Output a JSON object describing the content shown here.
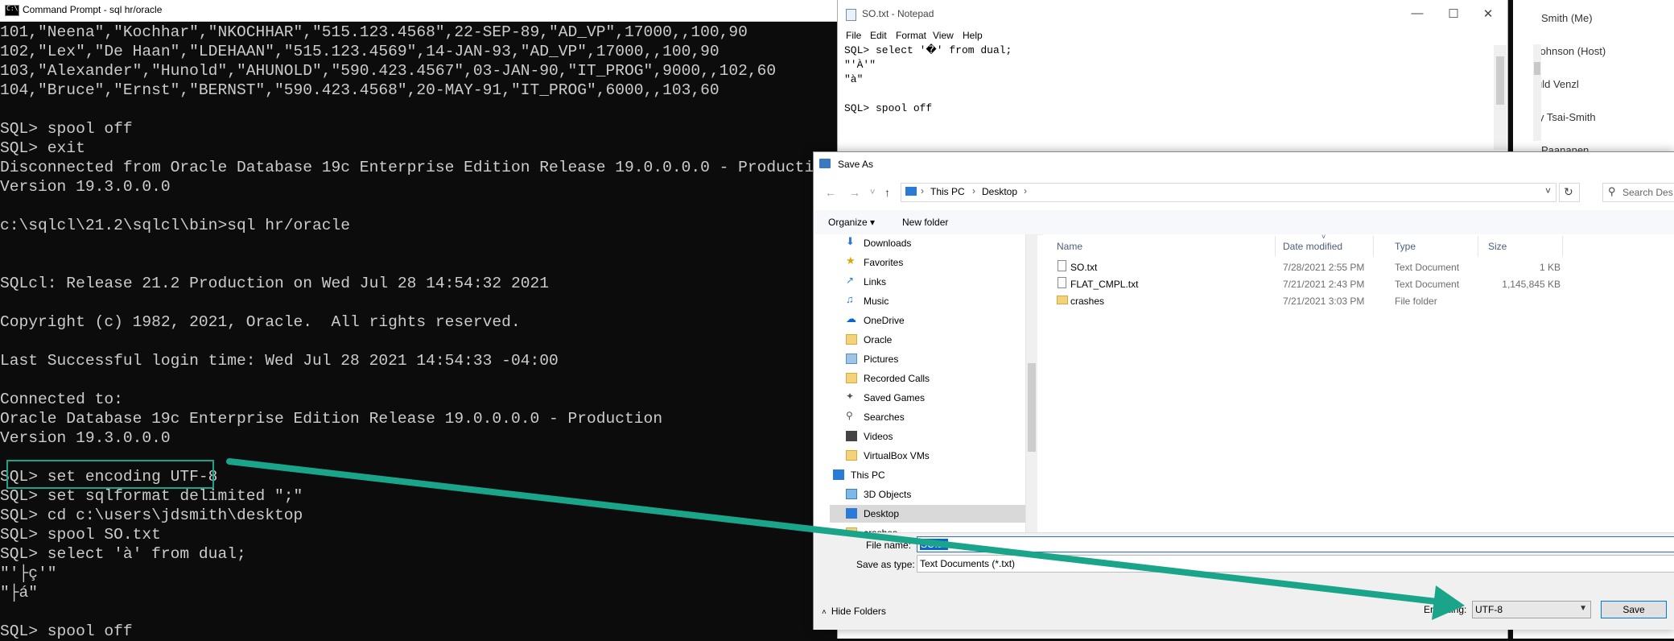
{
  "cmd": {
    "title": "Command Prompt - sql  hr/oracle",
    "lines": [
      "101,\"Neena\",\"Kochhar\",\"NKOCHHAR\",\"515.123.4568\",22-SEP-89,\"AD_VP\",17000,,100,90",
      "102,\"Lex\",\"De Haan\",\"LDEHAAN\",\"515.123.4569\",14-JAN-93,\"AD_VP\",17000,,100,90",
      "103,\"Alexander\",\"Hunold\",\"AHUNOLD\",\"590.423.4567\",03-JAN-90,\"IT_PROG\",9000,,102,60",
      "104,\"Bruce\",\"Ernst\",\"BERNST\",\"590.423.4568\",20-MAY-91,\"IT_PROG\",6000,,103,60",
      "",
      "SQL> spool off",
      "SQL> exit",
      "Disconnected from Oracle Database 19c Enterprise Edition Release 19.0.0.0.0 - Production",
      "Version 19.3.0.0.0",
      "",
      "c:\\sqlcl\\21.2\\sqlcl\\bin>sql hr/oracle",
      "",
      "",
      "SQLcl: Release 21.2 Production on Wed Jul 28 14:54:32 2021",
      "",
      "Copyright (c) 1982, 2021, Oracle.  All rights reserved.",
      "",
      "Last Successful login time: Wed Jul 28 2021 14:54:33 -04:00",
      "",
      "Connected to:",
      "Oracle Database 19c Enterprise Edition Release 19.0.0.0.0 - Production",
      "Version 19.3.0.0.0",
      "",
      "SQL> set encoding UTF-8",
      "SQL> set sqlformat delimited \";\"",
      "SQL> cd c:\\users\\jdsmith\\desktop",
      "SQL> spool SO.txt",
      "SQL> select 'à' from dual;",
      "\"'├ç'\"",
      "\"├á\"",
      "",
      "SQL> spool off"
    ]
  },
  "participants": [
    "Smith (Me)",
    "Johnson (Host)",
    "uld Venzl",
    "y Tsai-Smith",
    "Paananen"
  ],
  "notepad": {
    "title": "SO.txt - Notepad",
    "menu": [
      "File",
      "Edit",
      "Format",
      "View",
      "Help"
    ],
    "lines": [
      "SQL> select '�' from dual;",
      "\"'À'\"",
      "\"à\"",
      "",
      "SQL> spool off"
    ]
  },
  "save_as": {
    "title": "Save As",
    "breadcrumb": [
      "This PC",
      "Desktop"
    ],
    "search_placeholder": "Search Des",
    "organize": "Organize ▾",
    "new_folder": "New folder",
    "nav_items": [
      {
        "label": "Downloads",
        "icon": "download-icon"
      },
      {
        "label": "Favorites",
        "icon": "star-icon"
      },
      {
        "label": "Links",
        "icon": "link-icon"
      },
      {
        "label": "Music",
        "icon": "music-icon"
      },
      {
        "label": "OneDrive",
        "icon": "cloud-icon"
      },
      {
        "label": "Oracle",
        "icon": "folder-icon"
      },
      {
        "label": "Pictures",
        "icon": "pictures-icon"
      },
      {
        "label": "Recorded Calls",
        "icon": "folder-icon"
      },
      {
        "label": "Saved Games",
        "icon": "games-icon"
      },
      {
        "label": "Searches",
        "icon": "search-icon"
      },
      {
        "label": "Videos",
        "icon": "video-icon"
      },
      {
        "label": "VirtualBox VMs",
        "icon": "folder-icon"
      },
      {
        "label": "This PC",
        "icon": "computer-icon"
      },
      {
        "label": "3D Objects",
        "icon": "cube-icon"
      },
      {
        "label": "Desktop",
        "icon": "desktop-icon"
      },
      {
        "label": "crashes",
        "icon": "folder-icon"
      }
    ],
    "columns": {
      "name": "Name",
      "date": "Date modified",
      "type": "Type",
      "size": "Size"
    },
    "files": [
      {
        "name": "SO.txt",
        "date": "7/28/2021 2:55 PM",
        "type": "Text Document",
        "size": "1 KB",
        "icon": "text-file-icon"
      },
      {
        "name": "FLAT_CMPL.txt",
        "date": "7/21/2021 2:43 PM",
        "type": "Text Document",
        "size": "1,145,845 KB",
        "icon": "text-file-icon"
      },
      {
        "name": "crashes",
        "date": "7/21/2021 3:03 PM",
        "type": "File folder",
        "size": "",
        "icon": "folder-icon"
      }
    ],
    "file_name_label": "File name:",
    "file_name_value": "SO.txt",
    "save_as_type_label": "Save as type:",
    "save_as_type_value": "Text Documents (*.txt)",
    "hide_folders": "Hide Folders",
    "encoding_label": "Encoding:",
    "encoding_value": "UTF-8",
    "save_button": "Save"
  },
  "colors": {
    "accent": "#1aa58a",
    "cmd_bg": "#0c0c0c",
    "cmd_fg": "#cccccc"
  }
}
